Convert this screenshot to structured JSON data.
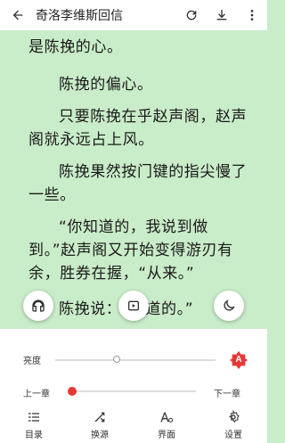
{
  "header": {
    "title": "奇洛李维斯回信"
  },
  "content": {
    "paragraphs": [
      "是陈挽的心。",
      "陈挽的偏心。",
      "只要陈挽在乎赵声阁，赵声阁就永远占上风。",
      "陈挽果然按门键的指尖慢了一些。",
      "“你知道的，我说到做到。”赵声阁又开始变得游刃有余，胜券在握，“从来。”",
      "陈挽说：“知道的。”"
    ]
  },
  "controls": {
    "brightness_label": "亮度",
    "auto_brightness_badge": "A",
    "prev_chapter": "上一章",
    "next_chapter": "下一章",
    "progress": 0
  },
  "bottom_nav": [
    {
      "label": "目录",
      "icon": "list-icon"
    },
    {
      "label": "换源",
      "icon": "swap-icon"
    },
    {
      "label": "界面",
      "icon": "font-icon"
    },
    {
      "label": "设置",
      "icon": "gear-icon"
    }
  ],
  "colors": {
    "page_bg": "#c9ecc9",
    "accent_red": "#e53935"
  }
}
